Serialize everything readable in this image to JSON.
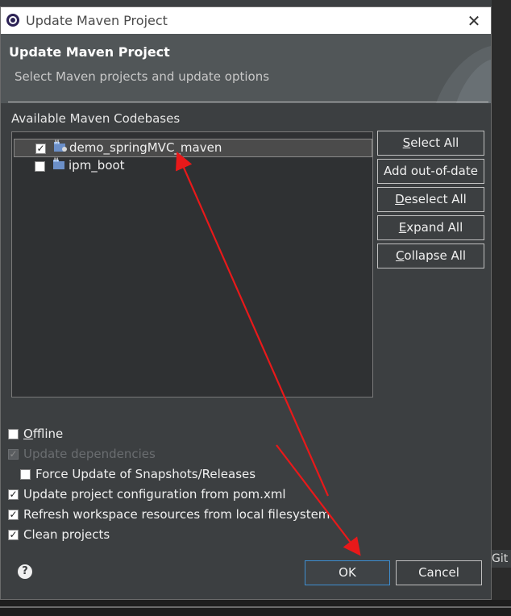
{
  "window": {
    "title": "Update Maven Project",
    "close_glyph": "✕",
    "app_icon": "eclipse-icon"
  },
  "banner": {
    "heading": "Update Maven Project",
    "subtitle": "Select Maven projects and update options"
  },
  "codebases": {
    "label": "Available Maven Codebases",
    "items": [
      {
        "label": "demo_springMVC_maven",
        "checked": true,
        "selected": true,
        "icon": "maven-project-icon"
      },
      {
        "label": "ipm_boot",
        "checked": false,
        "selected": false,
        "icon": "project-folder-icon"
      }
    ]
  },
  "side_buttons": {
    "select_all": {
      "mnemonic": "S",
      "rest": "elect All"
    },
    "add_out_of_date": "Add out-of-date",
    "deselect_all": {
      "mnemonic": "D",
      "rest": "eselect All"
    },
    "expand_all": {
      "mnemonic": "E",
      "rest": "xpand All"
    },
    "collapse_all": {
      "mnemonic": "C",
      "rest": "ollapse All"
    }
  },
  "options": {
    "offline": {
      "mnemonic": "O",
      "rest": "ffline",
      "checked": false
    },
    "update_dependencies": {
      "label": "Update dependencies",
      "checked": true,
      "disabled": true
    },
    "force_update": {
      "label": "Force Update of Snapshots/Releases",
      "checked": false
    },
    "update_config": {
      "label": "Update project configuration from pom.xml",
      "checked": true
    },
    "refresh_workspace": {
      "label": "Refresh workspace resources from local filesystem",
      "checked": true
    },
    "clean_projects": {
      "label": "Clean projects",
      "checked": true
    }
  },
  "footer": {
    "help_glyph": "?",
    "ok_label": "OK",
    "cancel_label": "Cancel"
  },
  "background_fragment": "Git S",
  "annotation_color": "#e8191a"
}
